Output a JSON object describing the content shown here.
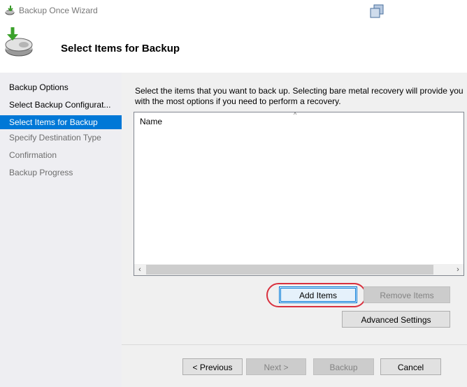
{
  "window": {
    "title": "Backup Once Wizard"
  },
  "header": {
    "title": "Select Items for Backup"
  },
  "steps": [
    {
      "label": "Backup Options",
      "state": "done"
    },
    {
      "label": "Select Backup Configurat...",
      "state": "done"
    },
    {
      "label": "Select Items for Backup",
      "state": "active"
    },
    {
      "label": "Specify Destination Type",
      "state": "pending"
    },
    {
      "label": "Confirmation",
      "state": "pending"
    },
    {
      "label": "Backup Progress",
      "state": "pending"
    }
  ],
  "main": {
    "instructions": "Select the items that you want to back up. Selecting bare metal recovery will provide you with the most options if you need to perform a recovery.",
    "list": {
      "column_header": "Name",
      "sort_indicator": "^",
      "items": []
    }
  },
  "buttons": {
    "add_items": "Add Items",
    "remove_items": "Remove Items",
    "advanced_settings": "Advanced Settings",
    "previous": "< Previous",
    "next": "Next >",
    "backup": "Backup",
    "cancel": "Cancel"
  },
  "icons": {
    "app": "backup-app-icon",
    "header": "backup-drive-icon",
    "restore": "restore-window-icon",
    "scroll_left": "scroll-left-arrow-icon",
    "scroll_right": "scroll-right-arrow-icon"
  },
  "colors": {
    "accent": "#0078d7",
    "highlight_ring": "#d9303e",
    "sidebar_bg": "#eeeef2",
    "content_bg": "#f0f0f0"
  }
}
